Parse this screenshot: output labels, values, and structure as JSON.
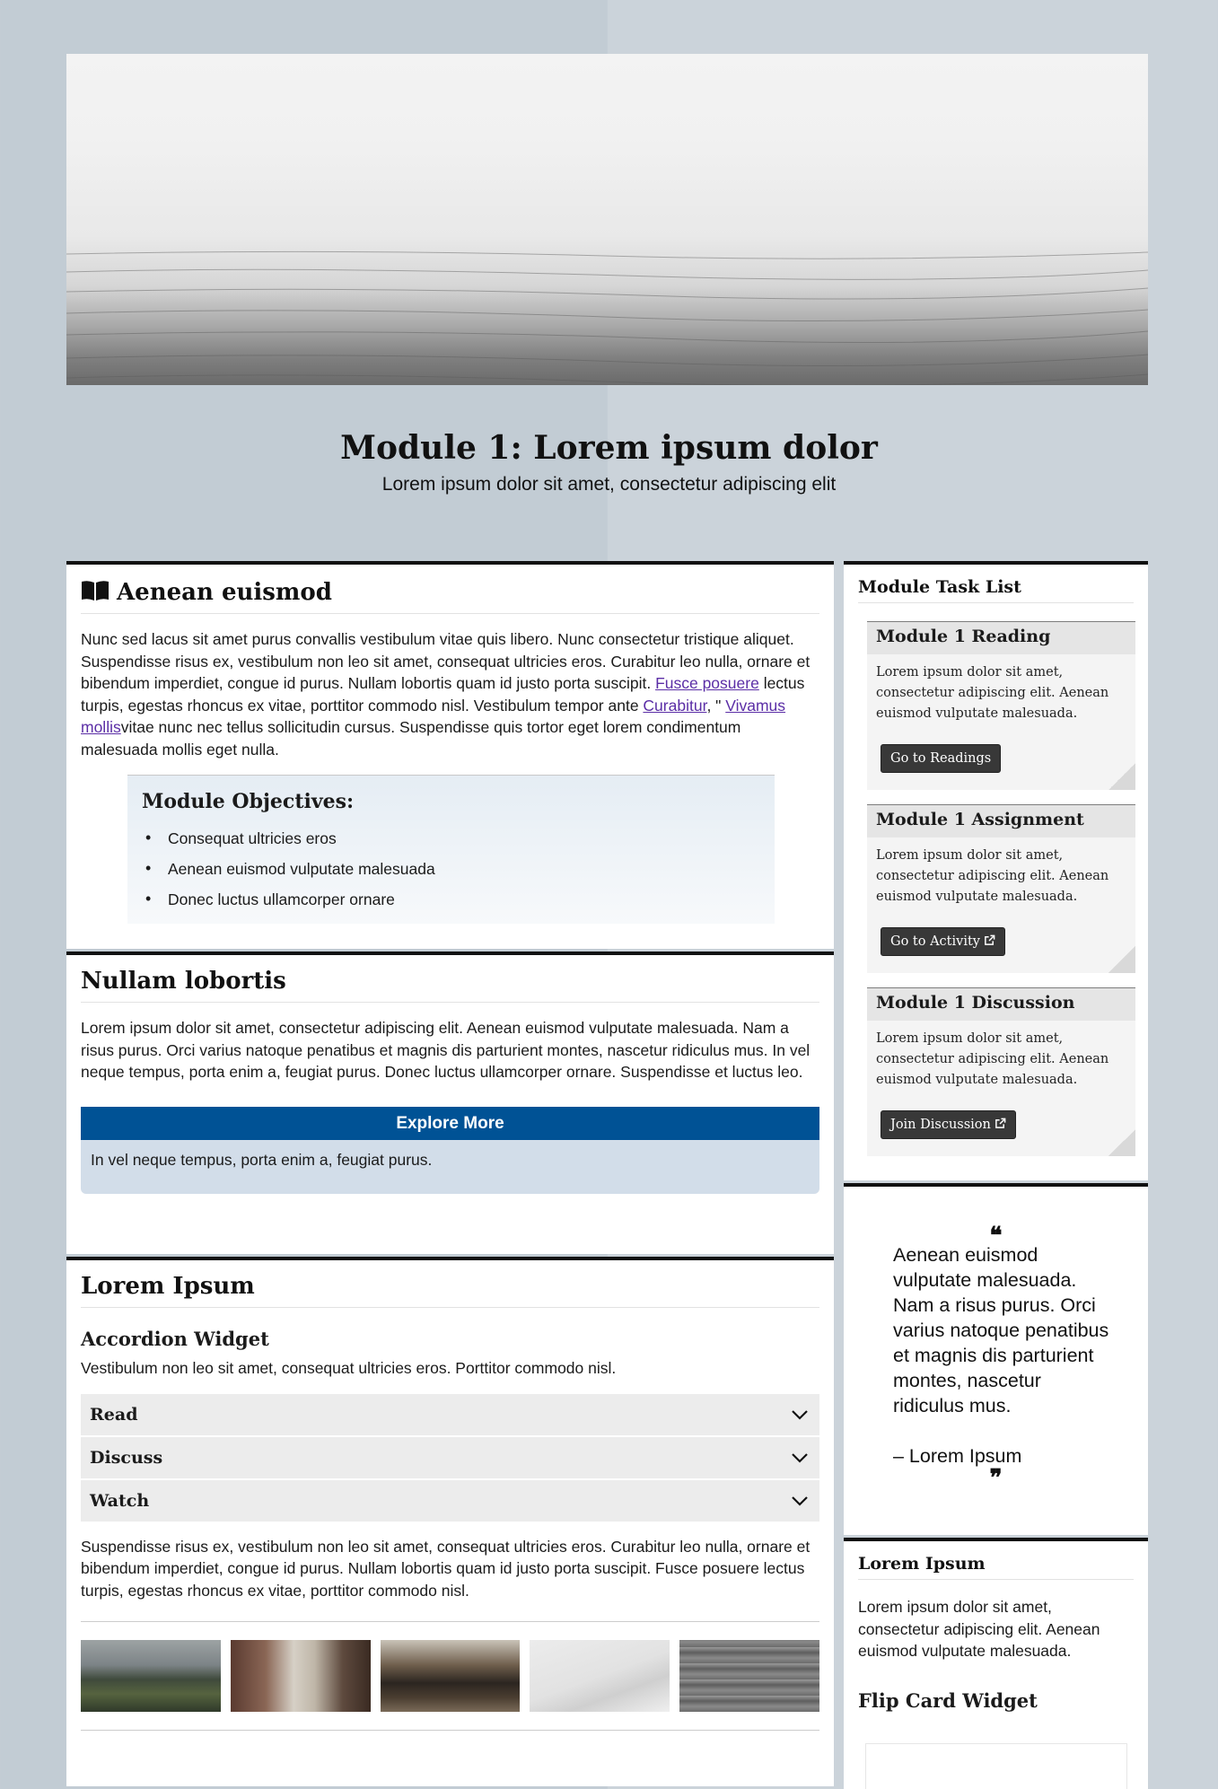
{
  "header": {
    "title": "Module 1: Lorem ipsum dolor",
    "subtitle": "Lorem ipsum dolor sit amet, consectetur adipiscing elit"
  },
  "intro": {
    "icon": "book-icon",
    "heading": "Aenean euismod",
    "text_1": "Nunc sed lacus sit amet purus convallis vestibulum vitae quis libero. Nunc consectetur tristique aliquet. Suspendisse risus ex, vestibulum non leo sit amet, consequat ultricies eros. Curabitur leo nulla, ornare et bibendum imperdiet, congue id purus. Nullam lobortis quam id justo porta suscipit. ",
    "link_1": "Fusce posuere",
    "text_2": " lectus turpis, egestas rhoncus ex vitae, porttitor commodo nisl. Vestibulum tempor ante ",
    "link_2": "Curabitur",
    "text_3": ", \" ",
    "link_3": "Vivamus mollis",
    "text_4": "vitae nunc nec tellus sollicitudin cursus. Suspendisse quis tortor eget lorem condimentum malesuada mollis eget nulla.",
    "objectives": {
      "heading": "Module Objectives:",
      "items": [
        "Consequat ultricies eros",
        "Aenean euismod vulputate malesuada",
        "Donec luctus ullamcorper ornare"
      ]
    }
  },
  "section2": {
    "heading": "Nullam lobortis",
    "text": "Lorem ipsum dolor sit amet, consectetur adipiscing elit. Aenean euismod vulputate malesuada. Nam a risus purus. Orci varius natoque penatibus et magnis dis parturient montes, nascetur ridiculus mus. In vel neque tempus, porta enim a, feugiat purus. Donec luctus ullamcorper ornare. Suspendisse et luctus leo.",
    "explore": {
      "label": "Explore More",
      "body": "In vel neque tempus, porta enim a, feugiat purus."
    }
  },
  "section3": {
    "heading": "Lorem Ipsum",
    "widget_title": "Accordion Widget",
    "widget_intro": "Vestibulum non leo sit amet, consequat ultricies eros. Porttitor commodo nisl.",
    "accordion": [
      {
        "label": "Read"
      },
      {
        "label": "Discuss"
      },
      {
        "label": "Watch"
      }
    ],
    "after_text": "Suspendisse risus ex, vestibulum non leo sit amet, consequat ultricies eros. Curabitur leo nulla, ornare et bibendum imperdiet, congue id purus. Nullam lobortis quam id justo porta suscipit. Fusce posuere lectus turpis, egestas rhoncus ex vitae, porttitor commodo nisl."
  },
  "tasks": {
    "heading": "Module Task List",
    "items": [
      {
        "title": "Module 1 Reading",
        "text": "Lorem ipsum dolor sit amet, consectetur adipiscing elit. Aenean euismod vulputate malesuada.",
        "button": "Go to Readings"
      },
      {
        "title": "Module 1 Assignment",
        "text": "Lorem ipsum dolor sit amet, consectetur adipiscing elit. Aenean euismod vulputate malesuada.",
        "button": "Go to Activity"
      },
      {
        "title": "Module 1 Discussion",
        "text": "Lorem ipsum dolor sit amet, consectetur adipiscing elit. Aenean euismod vulputate malesuada.",
        "button": "Join Discussion"
      }
    ]
  },
  "quote": {
    "open_mark": "❝",
    "text": "Aenean euismod vulputate malesuada. Nam a risus purus. Orci varius natoque penatibus et magnis dis parturient montes, nascetur ridiculus mus.",
    "author": "– Lorem Ipsum",
    "close_mark": "❞"
  },
  "sidebar_bottom": {
    "heading": "Lorem Ipsum",
    "text": "Lorem ipsum dolor sit amet, consectetur adipiscing elit. Aenean euismod vulputate malesuada.",
    "widget_title": "Flip Card Widget"
  },
  "colors": {
    "accent_blue": "#005295",
    "explore_body": "#d2dde9",
    "task_button": "#383838",
    "link": "#5b2ea6"
  }
}
